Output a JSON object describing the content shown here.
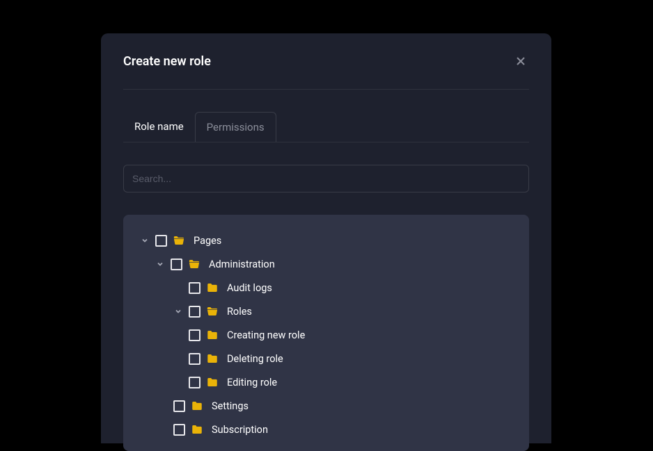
{
  "modal": {
    "title": "Create new role"
  },
  "tabs": {
    "role_name": "Role name",
    "permissions": "Permissions"
  },
  "search": {
    "placeholder": "Search..."
  },
  "tree": {
    "pages": "Pages",
    "administration": "Administration",
    "audit_logs": "Audit logs",
    "roles": "Roles",
    "creating_new_role": "Creating new role",
    "deleting_role": "Deleting role",
    "editing_role": "Editing role",
    "settings": "Settings",
    "subscription": "Subscription"
  },
  "colors": {
    "folder": "#eab308",
    "background": "#1e212e",
    "panel": "#303446"
  }
}
